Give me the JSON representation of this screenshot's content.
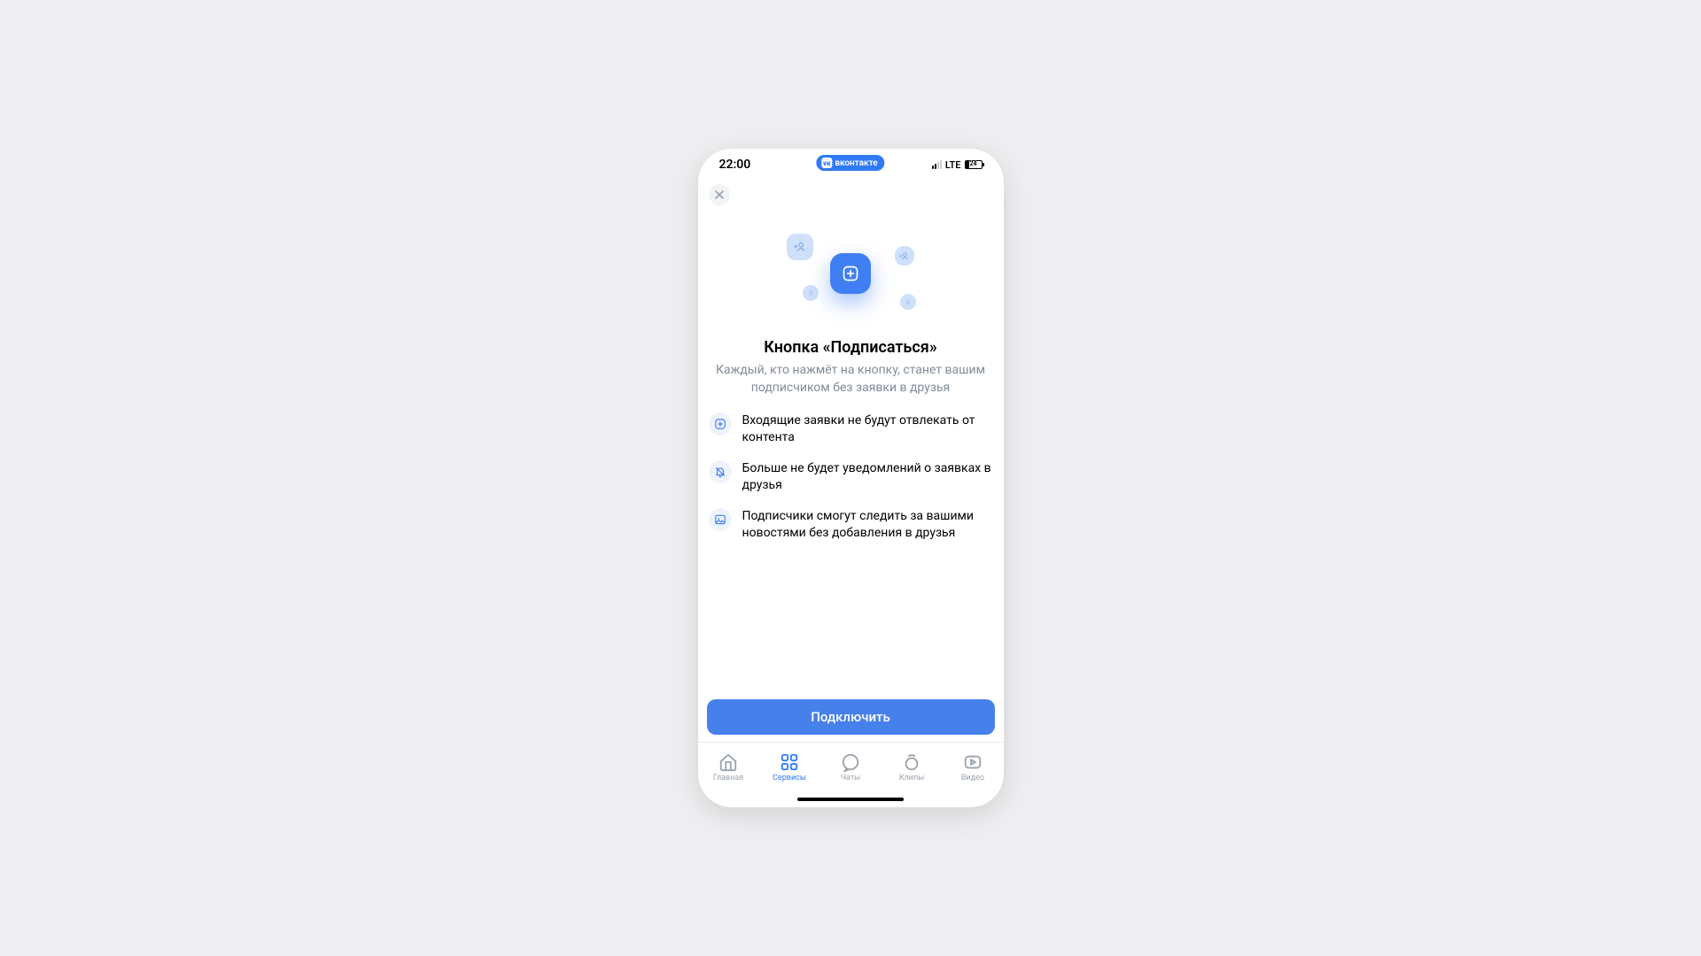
{
  "status": {
    "time": "22:00",
    "pill_text": "вконтакте",
    "network_label": "LTE",
    "battery_percent": "24"
  },
  "page": {
    "title": "Кнопка «Подписаться»",
    "subtitle": "Каждый, кто нажмёт на кнопку, станет вашим подписчиком без заявки в друзья"
  },
  "features": [
    {
      "text": "Входящие заявки не будут отвлекать от контента"
    },
    {
      "text": "Больше не будет уведомлений о заявках в друзья"
    },
    {
      "text": "Подписчики смогут следить за вашими новостями без добавления в друзья"
    }
  ],
  "cta": {
    "label": "Подключить"
  },
  "tabs": [
    {
      "label": "Главная"
    },
    {
      "label": "Сервисы"
    },
    {
      "label": "Чаты"
    },
    {
      "label": "Клипы"
    },
    {
      "label": "Видео"
    }
  ]
}
